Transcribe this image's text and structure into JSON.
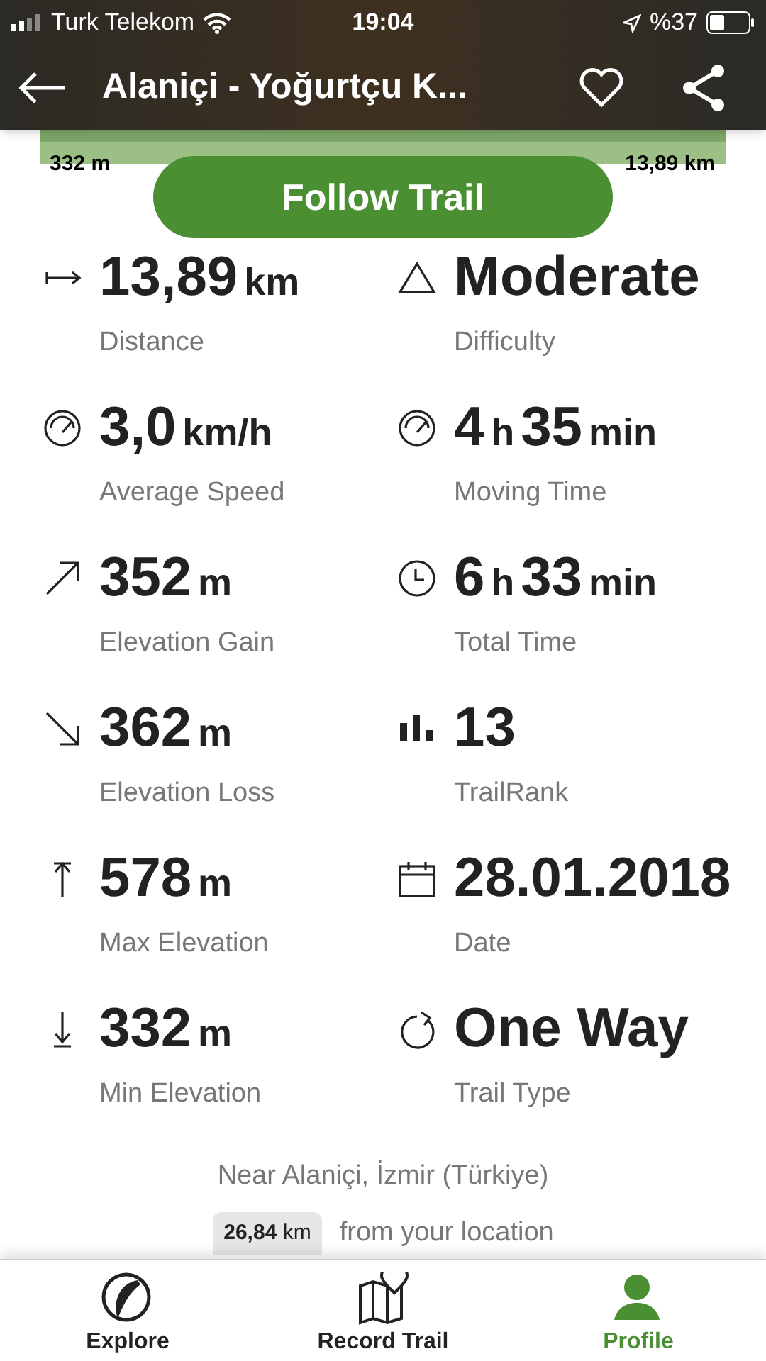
{
  "status_bar": {
    "carrier": "Turk Telekom",
    "time": "19:04",
    "battery": "%37"
  },
  "header": {
    "title": "Alaniçi - Yoğurtçu K..."
  },
  "elevation_profile": {
    "start": "332 m",
    "end": "13,89 km"
  },
  "follow_button": "Follow Trail",
  "stats": [
    {
      "kind": "distance",
      "parts": [
        {
          "text": "13,89",
          "kind": "number"
        },
        {
          "text": "km",
          "kind": "unit"
        }
      ],
      "label": "Distance"
    },
    {
      "kind": "difficulty",
      "parts": [
        {
          "text": "Moderate",
          "kind": "number"
        }
      ],
      "label": "Difficulty"
    },
    {
      "kind": "speed",
      "parts": [
        {
          "text": "3,0",
          "kind": "number"
        },
        {
          "text": "km/h",
          "kind": "unit"
        }
      ],
      "label": "Average Speed"
    },
    {
      "kind": "speed",
      "parts": [
        {
          "text": "4",
          "kind": "number"
        },
        {
          "text": "h",
          "kind": "unit"
        },
        {
          "text": "35",
          "kind": "number"
        },
        {
          "text": "min",
          "kind": "unit"
        }
      ],
      "label": "Moving Time"
    },
    {
      "kind": "gain",
      "parts": [
        {
          "text": "352",
          "kind": "number"
        },
        {
          "text": "m",
          "kind": "unit"
        }
      ],
      "label": "Elevation Gain"
    },
    {
      "kind": "clock",
      "parts": [
        {
          "text": "6",
          "kind": "number"
        },
        {
          "text": "h",
          "kind": "unit"
        },
        {
          "text": "33",
          "kind": "number"
        },
        {
          "text": "min",
          "kind": "unit"
        }
      ],
      "label": "Total Time"
    },
    {
      "kind": "loss",
      "parts": [
        {
          "text": "362",
          "kind": "number"
        },
        {
          "text": "m",
          "kind": "unit"
        }
      ],
      "label": "Elevation Loss"
    },
    {
      "kind": "rank",
      "parts": [
        {
          "text": "13",
          "kind": "number"
        }
      ],
      "label": "TrailRank"
    },
    {
      "kind": "max",
      "parts": [
        {
          "text": "578",
          "kind": "number"
        },
        {
          "text": "m",
          "kind": "unit"
        }
      ],
      "label": "Max Elevation"
    },
    {
      "kind": "calendar",
      "parts": [
        {
          "text": "28.01.2018",
          "kind": "number"
        }
      ],
      "label": "Date"
    },
    {
      "kind": "min",
      "parts": [
        {
          "text": "332",
          "kind": "number"
        },
        {
          "text": "m",
          "kind": "unit"
        }
      ],
      "label": "Min Elevation"
    },
    {
      "kind": "loop",
      "parts": [
        {
          "text": "One Way",
          "kind": "number"
        }
      ],
      "label": "Trail Type"
    }
  ],
  "location": {
    "near": "Near Alaniçi, İzmir (Türkiye)",
    "distance_number": "26,84",
    "distance_unit": "km",
    "distance_suffix": "from your location"
  },
  "tab_bar": [
    {
      "kind": "explore",
      "label": "Explore",
      "selected": false
    },
    {
      "kind": "map",
      "label": "Record Trail",
      "selected": false
    },
    {
      "kind": "person",
      "label": "Profile",
      "selected": true
    }
  ]
}
